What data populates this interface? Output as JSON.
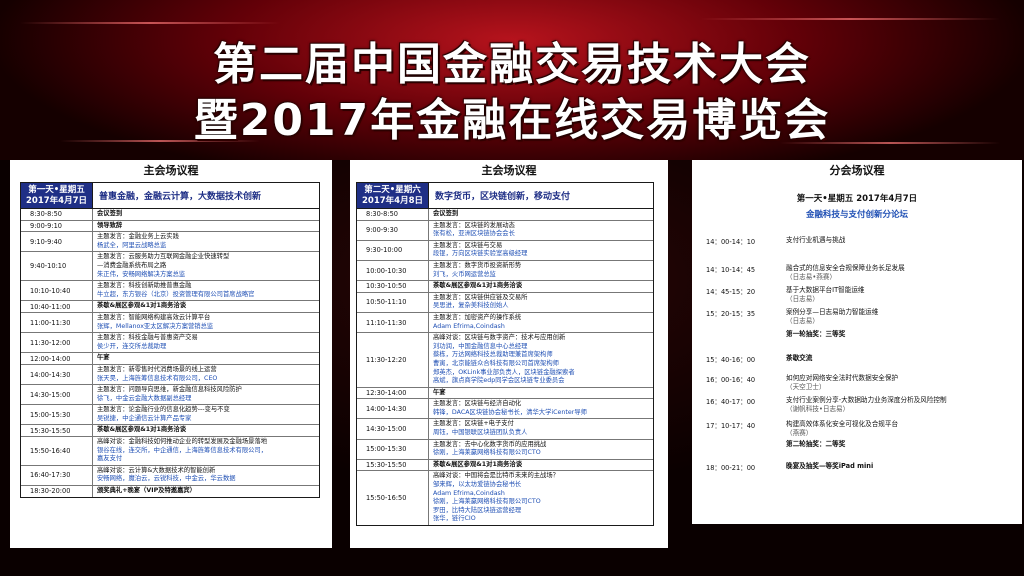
{
  "banner": {
    "title_line1": "第二届中国金融交易技术大会",
    "title_line2": "暨2017年金融在线交易博览会"
  },
  "panel1": {
    "heading": "主会场议程",
    "day": "第一天•星期五",
    "date": "2017年4月7日",
    "theme": "普惠金融，金融云计算，大数据技术创新",
    "rows": [
      {
        "time": "8:30-8:50",
        "lines": [
          "会议签到"
        ],
        "bold": true
      },
      {
        "time": "9:00-9:10",
        "lines": [
          "领导致辞"
        ],
        "bold": true
      },
      {
        "time": "9:10-9:40",
        "lines": [
          "主题发言：金融业务上云实践",
          "杨武全，阿里云战略总监"
        ]
      },
      {
        "time": "9:40-10:10",
        "lines": [
          "主题发言：云服务助力互联网金融企业快速转型",
          "—消费金融系统布局之路",
          "朱正伟，安畅网络解决方案总监"
        ]
      },
      {
        "time": "10:10-10:40",
        "lines": [
          "主题发言：科技创新助推普惠金融",
          "牛立超，东方银谷（北京）投资管理有限公司首席战略官"
        ]
      },
      {
        "time": "10:40-11:00",
        "lines": [
          "茶歇&展区参观&1对1商务洽谈"
        ],
        "bold": true
      },
      {
        "time": "11:00-11:30",
        "lines": [
          "主题发言：智能网络构建高效云计算平台",
          "张辉，Mellanox亚太区解决方案营销总监"
        ]
      },
      {
        "time": "11:30-12:00",
        "lines": [
          "主题发言：科技金融与普惠资产交易",
          "侯少开，连交所总裁助理"
        ]
      },
      {
        "time": "12:00-14:00",
        "lines": [
          "午宴"
        ],
        "bold": true
      },
      {
        "time": "14:00-14:30",
        "lines": [
          "主题发言：新零售时代消费场景的线上运营",
          "张天昊，上海旌筹信息技术有限公司，CEO"
        ]
      },
      {
        "time": "14:30-15:00",
        "lines": [
          "主题发言：问题导向思维，新金融信息科技风险防护",
          "徐飞，中金云金融大数据副总经理"
        ]
      },
      {
        "time": "15:00-15:30",
        "lines": [
          "主题发言：论金融行业的信息化趋势---变与不变",
          "吴锐捷，中企通信云计算产品专家"
        ]
      },
      {
        "time": "15:30-15:50",
        "lines": [
          "茶歇&展区参观&1对1商务洽谈"
        ],
        "bold": true
      },
      {
        "time": "15:50-16:40",
        "lines": [
          "高峰对谈：金融科技如何推动企业的转型发展及金融场景落地",
          "银谷在线，连交所，中企通信，上海旌筹信息技术有限公司，",
          "嘉友支付"
        ]
      },
      {
        "time": "16:40-17:30",
        "lines": [
          "高峰对谈：云计算&大数据技术的智能创新",
          "安畅网络，魔泊云，云锐科技，中金云，华云数据"
        ]
      },
      {
        "time": "18:30-20:00",
        "lines": [
          "颁奖典礼+晚宴（VIP及特邀嘉宾）"
        ],
        "bold": true
      }
    ]
  },
  "panel2": {
    "heading": "主会场议程",
    "day": "第二天•星期六",
    "date": "2017年4月8日",
    "theme": "数字货币，区块链创新，移动支付",
    "rows": [
      {
        "time": "8:30-8:50",
        "lines": [
          "会议签到"
        ],
        "bold": true
      },
      {
        "time": "9:00-9:30",
        "lines": [
          "主题发言：区块链的发展动态",
          "张有松，亚洲区块链协会会长"
        ]
      },
      {
        "time": "9:30-10:00",
        "lines": [
          "主题发言：区块链与交易",
          "段锟，万向区块链实验室高级经理"
        ]
      },
      {
        "time": "10:00-10:30",
        "lines": [
          "主题发言：数字货币投资新形势",
          "刘飞，火币网运营总监"
        ]
      },
      {
        "time": "10:30-10:50",
        "lines": [
          "茶歇&展区参观&1对1商务洽谈"
        ],
        "bold": true
      },
      {
        "time": "10:50-11:10",
        "lines": [
          "主题发言：区块链供应链及交易所",
          "吴思进，复杂美科技创始人"
        ]
      },
      {
        "time": "11:10-11:30",
        "lines": [
          "主题发言：加密资产的操作系统",
          "Adam Efrima,Coindash"
        ]
      },
      {
        "time": "11:30-12:20",
        "lines": [
          "高峰对谈：区块链与数字资产：技术与应用创新",
          "刘功润，中国金融信息中心总经理",
          "蔡栋，万达网络科技总裁助理兼首席架构师",
          "曹寅，北京能链众合科技有限公司首席架构师",
          "郑英杰，OKLink事业部负责人，区块链金融探索者",
          "高斌，旗点商学院edp同学会区块链专业委员会"
        ]
      },
      {
        "time": "12:30-14:00",
        "lines": [
          "午宴"
        ],
        "bold": true
      },
      {
        "time": "14:00-14:30",
        "lines": [
          "主题发言：区块链与经济自动化",
          "韩锋，DACA区块链协会秘书长，清华大学iCenter导师"
        ]
      },
      {
        "time": "14:30-15:00",
        "lines": [
          "主题发言：区块链+电子支付",
          "周钰，中国银联区块链团队负责人"
        ]
      },
      {
        "time": "15:00-15:30",
        "lines": [
          "主题发言：去中心化数字货币的应用挑战",
          "徐刚，上海莱赢网络科技有限公司CTO"
        ]
      },
      {
        "time": "15:30-15:50",
        "lines": [
          "茶歇&展区参观&1对1商务洽谈"
        ],
        "bold": true
      },
      {
        "time": "15:50-16:50",
        "lines": [
          "高峰对谈：中国将会是比特币未来的主战场？",
          "邹来辉，以太坊爱链协会秘书长",
          "Adam Efrima,Coindash",
          "徐刚，上海莱赢网络科技有限公司CTO",
          "罗田，比特大陆区块链运营经理",
          "张华，链行CIO"
        ]
      }
    ]
  },
  "panel3": {
    "heading": "分会场议程",
    "date_line": "第一天•星期五  2017年4月7日",
    "sub": "金融科技与支付创新分论坛",
    "items": [
      {
        "time": "14：00-14：10",
        "lines": [
          "支付行业机遇与挑战"
        ]
      },
      {
        "time": "14：10-14：45",
        "lines": [
          "融合式的信息安全合规保障业务长足发展",
          "（日志易•燕赛）"
        ]
      },
      {
        "time": "14：45-15：20",
        "lines": [
          "基于大数据平台IT智能运维",
          "（日志易）"
        ]
      },
      {
        "time": "15：20-15：35",
        "lines": [
          "案例分享—日志易助力智能运维",
          "（日志易）"
        ]
      },
      {
        "time": "",
        "lines": [
          "第一轮抽奖：三等奖"
        ],
        "bold": true
      },
      {
        "time": "15：40-16：00",
        "lines": [
          "茶歇交流"
        ],
        "bold": true
      },
      {
        "time": "16：00-16：40",
        "lines": [
          "如何应对网络安全法时代数据安全保护",
          "（天空卫士）"
        ]
      },
      {
        "time": "16：40-17：00",
        "lines": [
          "支付行业案例分享-大数据助力业务深度分析及风险控制",
          "（谢帆科技•日志易）"
        ]
      },
      {
        "time": "17：10-17：40",
        "lines": [
          "构建高效体系化安全可视化及合规平台",
          "（燕赛）"
        ]
      },
      {
        "time": "",
        "lines": [
          "第二轮抽奖：二等奖"
        ],
        "bold": true
      },
      {
        "time": "18：00-21：00",
        "lines": [
          "晚宴及抽奖—等奖iPad mini"
        ],
        "bold": true
      }
    ]
  },
  "colors": {
    "accent_blue": "#1f2f86",
    "speaker_blue": "#1f4fb4",
    "banner_red": "#b0141e"
  }
}
